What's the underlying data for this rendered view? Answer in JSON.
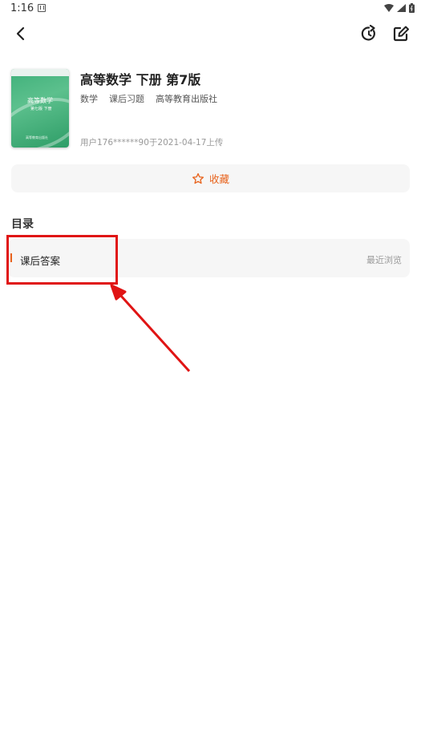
{
  "status_bar": {
    "time": "1:16",
    "icons": [
      "notification-a-icon",
      "wifi-icon",
      "signal-icon",
      "battery-icon"
    ]
  },
  "toolbar": {
    "icons": [
      "back-arrow-icon",
      "refresh-icon",
      "edit-icon"
    ]
  },
  "book": {
    "title": "高等数学 下册 第7版",
    "tags": [
      "数学",
      "课后习题",
      "高等教育出版社"
    ],
    "upload_info": "用户176******90于2021-04-17上传",
    "cover": {
      "title": "高等数学",
      "subtitle": "第七版 下册",
      "publisher": "高等教育出版社",
      "color": "#3fb07a"
    }
  },
  "favorite": {
    "label": "收藏",
    "icon": "star-outline-icon",
    "color": "#e8641e"
  },
  "toc": {
    "title": "目录",
    "items": [
      {
        "label": "课后答案",
        "recent": "最近浏览"
      }
    ]
  },
  "annotation": {
    "color": "#e01414"
  }
}
